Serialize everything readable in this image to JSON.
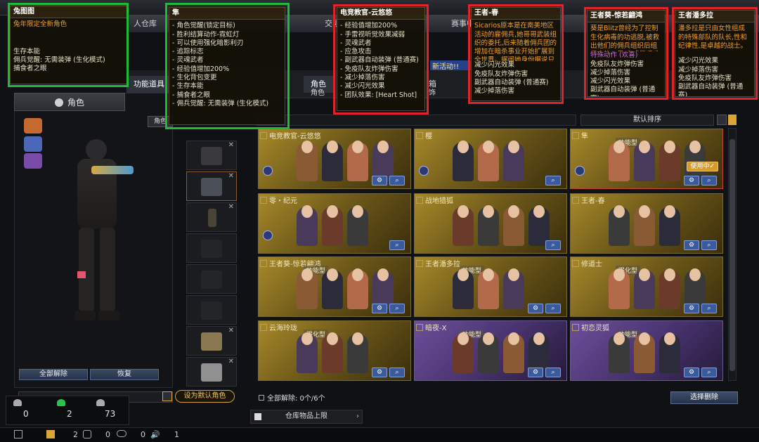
{
  "topnav": {
    "storage": "人仓库",
    "trade": "交易",
    "season": "赛事中"
  },
  "subnav": {
    "abilities": "功能道具",
    "role": "角色",
    "box": "箱",
    "decoration": "饰"
  },
  "event_banner": "新活动!!",
  "left": {
    "char_tab": "角色",
    "role_tag": "角色",
    "release_all": "全部解除",
    "restore": "恢复",
    "set_default": "设为默认角色"
  },
  "stats": {
    "a": "0",
    "b": "2",
    "c": "73"
  },
  "statusbar": {
    "a": "2",
    "b": "0",
    "c": "0",
    "d": "1"
  },
  "grid": {
    "sort_label": "默认排序",
    "release_count": "全部解除: 0个/6个",
    "select_delete": "选择删除",
    "storage_limit": "仓库物品上限"
  },
  "cards": [
    {
      "name": "电竞教官-云悠悠",
      "tag": "",
      "in_use": false
    },
    {
      "name": "樱",
      "tag": "",
      "in_use": false
    },
    {
      "name": "隼",
      "tag": "功能型",
      "in_use": true,
      "in_use_label": "使用中✓"
    },
    {
      "name": "零・纪元",
      "tag": "",
      "in_use": false
    },
    {
      "name": "战地猎狐",
      "tag": "",
      "in_use": false
    },
    {
      "name": "王者-春",
      "tag": "",
      "in_use": false
    },
    {
      "name": "王者葵-惊若翩鸿",
      "tag": "功能型",
      "in_use": false
    },
    {
      "name": "王者潘多拉",
      "tag": "功能型",
      "in_use": false
    },
    {
      "name": "修道士",
      "tag": "强化型",
      "in_use": false
    },
    {
      "name": "云海玲珑",
      "tag": "强化型",
      "in_use": false
    },
    {
      "name": "暗夜-X",
      "tag": "功能型",
      "in_use": false
    },
    {
      "name": "初恋灵狐",
      "tag": "功能型",
      "in_use": false
    }
  ],
  "tips": {
    "rabbit": {
      "title": "兔图图",
      "line1": "兔年限定全新角色",
      "lines": [
        "生存本能",
        "佣兵觉醒: 无需装弹 (生化模式)",
        "捕食者之眼"
      ]
    },
    "hayabusa": {
      "title": "隼",
      "lines": [
        "- 角色觉醒(锁定目标)",
        "- 胜利结算动作-霓虹灯",
        "- 可以使用强化暗影利刃",
        "- 追踪标志",
        "- 灵魂武者",
        "- 经验值增加200%",
        "- 生化背包变更",
        "- 生存本能",
        "- 捕食者之眼",
        "- 佣兵觉醒: 无需装弹 (生化模式)"
      ]
    },
    "yunyouyou": {
      "title": "电竞教官-云悠悠",
      "lines": [
        "- 经验值增加200%",
        "- 手雷视听觉效果减弱",
        "- 灵魂武者",
        "- 应急攻击",
        "- 副武器自动装弹 (普通赛)",
        "- 免疫队友炸弹伤害",
        "- 减少掉落伤害",
        "- 减少闪光效果",
        "- 团队效果: [Heart Shot]"
      ]
    },
    "chun": {
      "title": "王者-春",
      "desc": "Sicarios原本是在南美地区活动的雇佣兵,她哥哥武装组织的委托,后来随着佣兵团的增加在暗杀事业开始扩展到全世界。据闻她身份据说只有达成最高业绩的人员才能获悉。",
      "lines": [
        "减少闪光效果",
        "免疫队友炸弹伤害",
        "副武器自动装弹 (普通赛)",
        "减少掉落伤害"
      ]
    },
    "kui": {
      "title": "王者葵-惊若翩鸿",
      "desc": "葵是Blitz曾经为了控制生化病毒的功逃脱,被救出他们的佣兵组织后组织中的一员,完成最艰难任务的王牌中留。",
      "special": "特殊动作 (欢喜)",
      "lines": [
        "免疫队友炸弹伤害",
        "减少掉落伤害",
        "减少闪光效果",
        "副武器自动装弹 (普通赛)"
      ]
    },
    "pandora": {
      "title": "王者潘多拉",
      "desc": "潘多拉是只由女性组成的特殊部队的队长,性和纪律性,是卓越的战士。",
      "lines": [
        "减少闪光效果",
        "减少掉落伤害",
        "免疫队友炸弹伤害",
        "副武器自动装弹 (普通赛)"
      ]
    }
  },
  "colors": {
    "green_frame": "#1fba3a",
    "red_frame": "#e0222b",
    "accent_gold": "#d9a537",
    "card_gold": "#a88a2a",
    "card_purple": "#6c4f9a"
  }
}
